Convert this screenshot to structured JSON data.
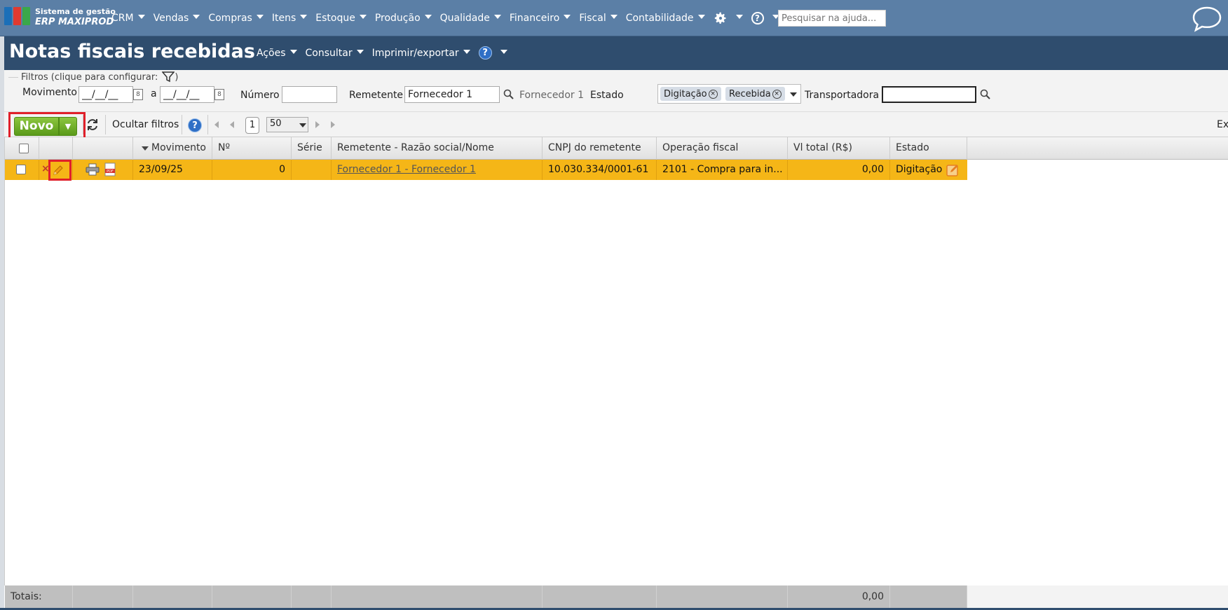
{
  "brand": {
    "line1": "Sistema de gestão",
    "line2": "ERP MAXIPROD"
  },
  "topmenu": [
    "CRM",
    "Vendas",
    "Compras",
    "Itens",
    "Estoque",
    "Produção",
    "Qualidade",
    "Financeiro",
    "Fiscal",
    "Contabilidade"
  ],
  "help_search": {
    "placeholder": "Pesquisar na ajuda..."
  },
  "page": {
    "title": "Notas fiscais recebidas"
  },
  "header_menu": {
    "acoes": "Ações",
    "consultar": "Consultar",
    "imprimir": "Imprimir/exportar",
    "help": "?"
  },
  "filters": {
    "legend": "Filtros (clique para configurar:",
    "legend_close": ")",
    "movimento_label": "Movimento",
    "date_from": "__/__/__",
    "a_label": "a",
    "date_to": "__/__/__",
    "numero_label": "Número",
    "numero_value": "",
    "remetente_label": "Remetente",
    "remetente_value": "Fornecedor 1",
    "remetente_display": "Fornecedor 1",
    "estado_label": "Estado",
    "estado_tags": [
      "Digitação",
      "Recebida"
    ],
    "transportadora_label": "Transportadora",
    "transportadora_value": ""
  },
  "toolbar": {
    "novo": "Novo",
    "ocultar": "Ocultar filtros",
    "page": "1",
    "page_size": "50",
    "export": "Ex"
  },
  "grid": {
    "columns": [
      "Movimento",
      "Nº",
      "Série",
      "Remetente - Razão social/Nome",
      "CNPJ do remetente",
      "Operação fiscal",
      "Vl total (R$)",
      "Estado"
    ],
    "rows": [
      {
        "movimento": "23/09/25",
        "numero": "0",
        "serie": "",
        "remetente": "Fornecedor 1 - Fornecedor 1",
        "cnpj": "10.030.334/0001-61",
        "operacao": "2101 - Compra para in...",
        "valor": "0,00",
        "estado": "Digitação"
      }
    ],
    "totals_label": "Totais:",
    "totals_value": "0,00"
  },
  "colors": {
    "nav": "#5b7fa6",
    "header": "#2f4d6e",
    "selected_row": "#f5b617",
    "novo_button": "#6aaa24",
    "highlight": "#e0202a"
  }
}
